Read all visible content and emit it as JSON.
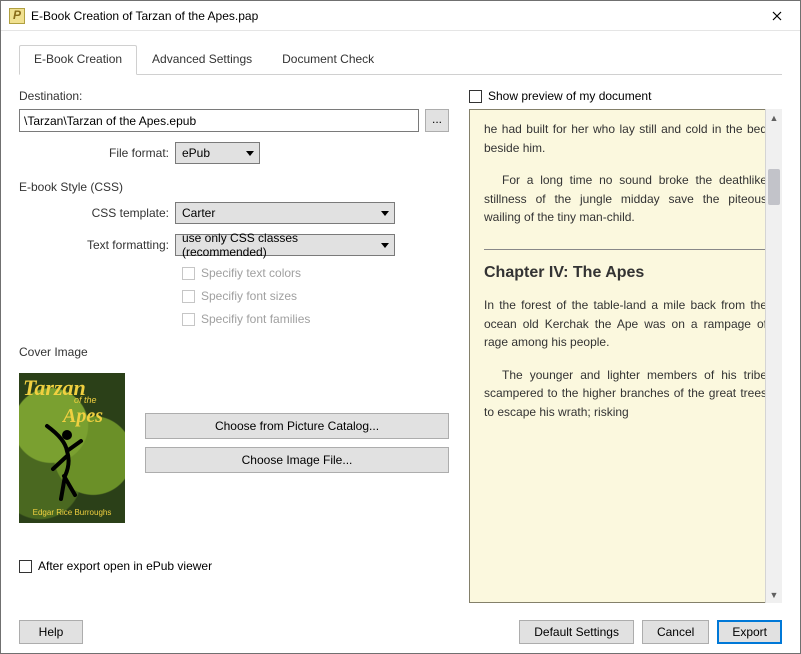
{
  "window": {
    "title": "E-Book Creation of Tarzan of the Apes.pap"
  },
  "tabs": {
    "t0": "E-Book Creation",
    "t1": "Advanced Settings",
    "t2": "Document Check"
  },
  "left": {
    "destination_label": "Destination:",
    "destination_value": "\\Tarzan\\Tarzan of the Apes.epub",
    "dots": "...",
    "file_format_label": "File format:",
    "file_format_value": "ePub",
    "style_section": "E-book Style (CSS)",
    "css_template_label": "CSS template:",
    "css_template_value": "Carter",
    "text_formatting_label": "Text formatting:",
    "text_formatting_value": "use only CSS classes (recommended)",
    "spec_colors": "Specifiy text colors",
    "spec_sizes": "Specifiy font sizes",
    "spec_families": "Specifiy font families",
    "cover_section": "Cover Image",
    "cover_title1": "Tarzan",
    "cover_ofthe": "of the",
    "cover_title2": "Apes",
    "cover_author": "Edgar Rice Burroughs",
    "choose_catalog": "Choose from Picture Catalog...",
    "choose_file": "Choose Image File...",
    "after_export": "After export open in ePub viewer"
  },
  "right": {
    "show_preview": "Show preview of my document",
    "p1": "he had built for her who lay still and cold in the bed beside him.",
    "p2": "For a long time no sound broke the deathlike stillness of the jungle midday save the piteous wailing of the tiny man-child.",
    "chapter": "Chapter IV: The Apes",
    "p3": "In the forest of the table-land a mile back from the ocean old Kerchak the Ape was on a rampage of rage among his people.",
    "p4": "The younger and lighter members of his tribe scampered to the higher branches of the great trees to escape his wrath; risking"
  },
  "footer": {
    "help": "Help",
    "defaults": "Default Settings",
    "cancel": "Cancel",
    "export": "Export"
  }
}
